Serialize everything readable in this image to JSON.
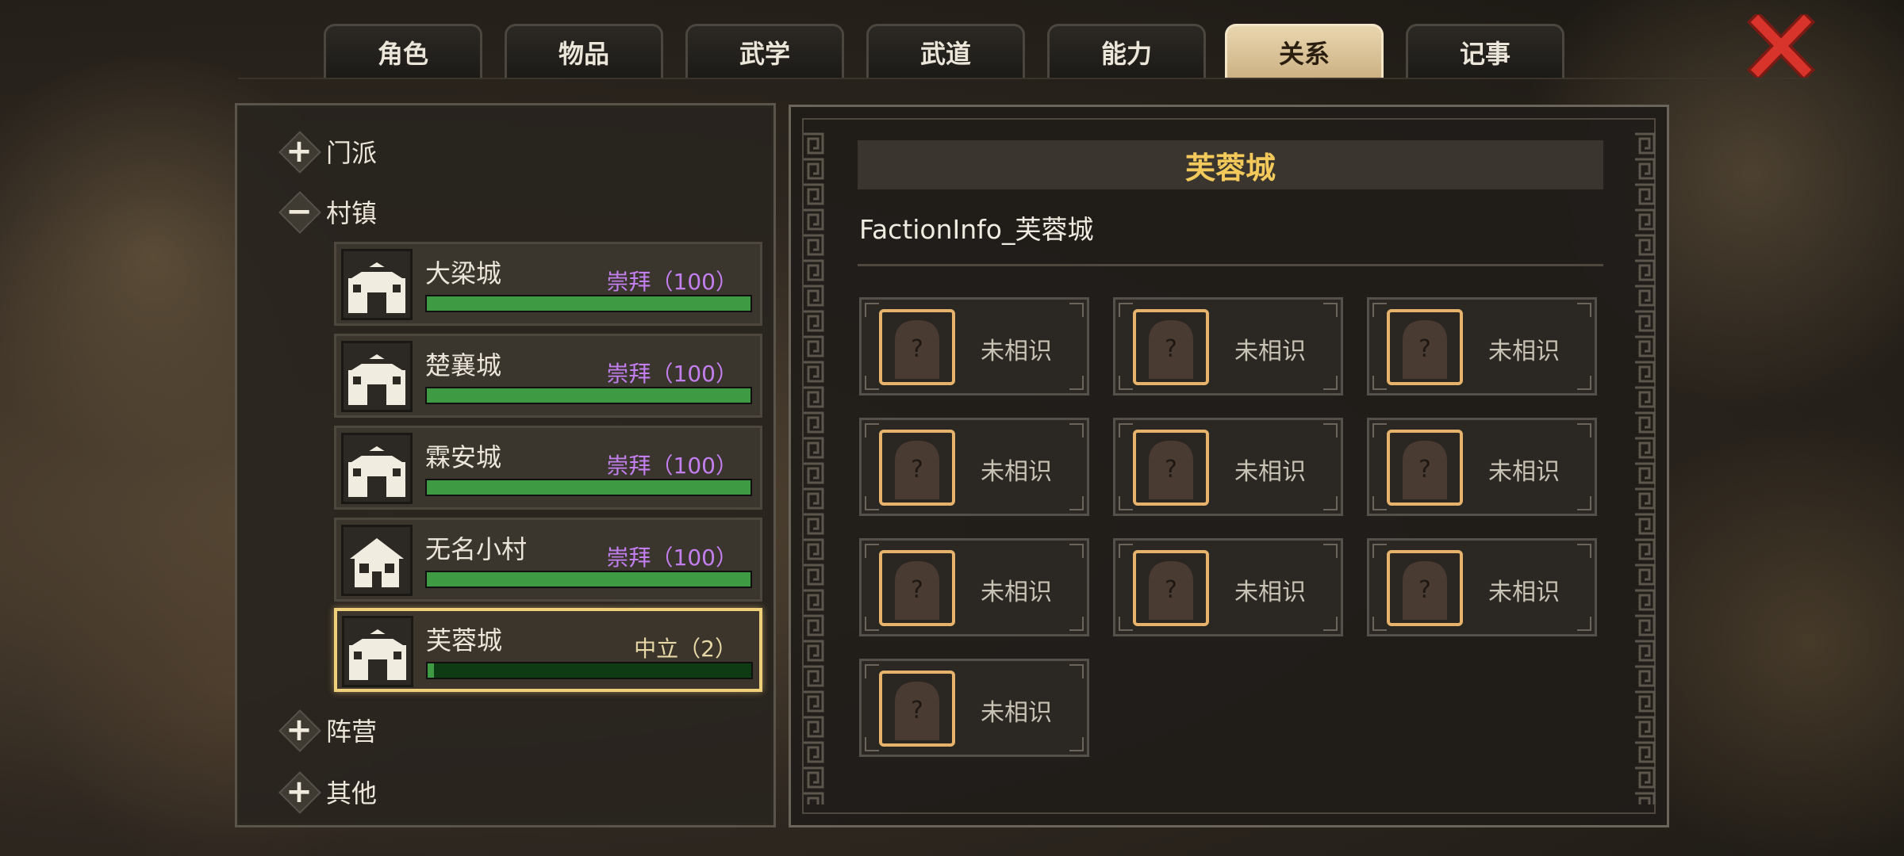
{
  "tabs": [
    {
      "label": "角色"
    },
    {
      "label": "物品"
    },
    {
      "label": "武学"
    },
    {
      "label": "武道"
    },
    {
      "label": "能力"
    },
    {
      "label": "关系"
    },
    {
      "label": "记事"
    }
  ],
  "active_tab": "关系",
  "sidebar": {
    "categories": [
      {
        "label": "门派",
        "icon": "+"
      },
      {
        "label": "村镇",
        "icon": "−"
      },
      {
        "label": "阵营",
        "icon": "+"
      },
      {
        "label": "其他",
        "icon": "+"
      }
    ],
    "towns": [
      {
        "name": "大梁城",
        "status": "崇拜（100）",
        "progress": 1.0
      },
      {
        "name": "楚襄城",
        "status": "崇拜（100）",
        "progress": 1.0
      },
      {
        "name": "霖安城",
        "status": "崇拜（100）",
        "progress": 1.0
      },
      {
        "name": "无名小村",
        "status": "崇拜（100）",
        "progress": 1.0
      },
      {
        "name": "芙蓉城",
        "status": "中立（2）",
        "progress": 0.02
      }
    ]
  },
  "detail": {
    "title": "芙蓉城",
    "info": "FactionInfo_芙蓉城",
    "members": [
      {
        "label": "未相识"
      },
      {
        "label": "未相识"
      },
      {
        "label": "未相识"
      },
      {
        "label": "未相识"
      },
      {
        "label": "未相识"
      },
      {
        "label": "未相识"
      },
      {
        "label": "未相识"
      },
      {
        "label": "未相识"
      },
      {
        "label": "未相识"
      },
      {
        "label": "未相识"
      }
    ]
  },
  "colors": {
    "tab_active": "#e9d6ae",
    "worship_text": "#c37ff0",
    "neutral_text": "#e8d8a6",
    "bar_fill": "#3e9a43",
    "title_gold": "#f2c95a",
    "close_red": "#d9342b"
  },
  "icons": {
    "close": "close-icon",
    "town": "town-gate-icon",
    "village": "house-icon",
    "unknown_person": "question-silhouette-icon"
  }
}
